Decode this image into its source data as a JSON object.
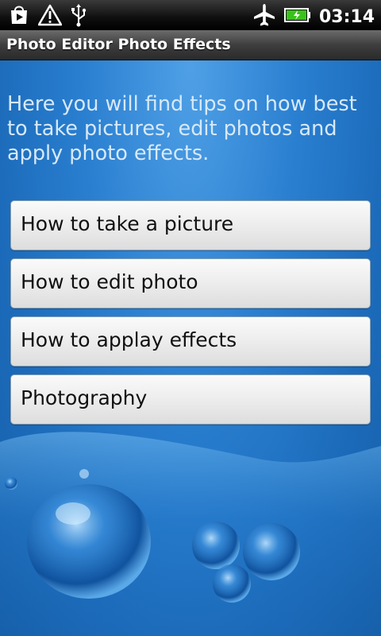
{
  "status_bar": {
    "time": "03:14",
    "icons": [
      "play-store-icon",
      "warning-icon",
      "usb-icon",
      "airplane-icon",
      "battery-charging-icon"
    ]
  },
  "app": {
    "title": "Photo Editor Photo Effects"
  },
  "intro_text": "Here you will find tips on how best to take pictures, edit photos and apply photo effects.",
  "menu": {
    "items": [
      {
        "label": "How to take a picture"
      },
      {
        "label": "How to edit photo"
      },
      {
        "label": "How to applay effects"
      },
      {
        "label": "Photography"
      }
    ]
  },
  "colors": {
    "background_blue": "#1a6fc2",
    "intro_text": "#d7e9f8",
    "battery_green": "#38c31a"
  }
}
